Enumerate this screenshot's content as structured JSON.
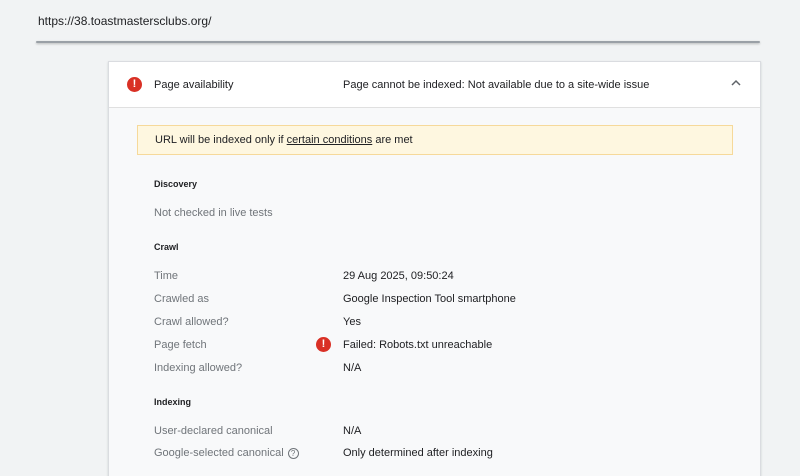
{
  "browser": {
    "url": "https://38.toastmastersclubs.org/"
  },
  "header": {
    "title": "Page availability",
    "status": "Page cannot be indexed: Not available due to a site-wide issue",
    "error_icon": "!",
    "chevron_icon": "chevron-up-icon"
  },
  "notice": {
    "prefix": "URL will be indexed only if ",
    "link": "certain conditions",
    "suffix": " are met",
    "bg_color": "#fef7e0"
  },
  "discovery": {
    "heading": "Discovery",
    "note": "Not checked in live tests"
  },
  "crawl": {
    "heading": "Crawl",
    "rows": [
      {
        "label": "Time",
        "value": "29 Aug 2025, 09:50:24"
      },
      {
        "label": "Crawled as",
        "value": "Google Inspection Tool smartphone"
      },
      {
        "label": "Crawl allowed?",
        "value": "Yes"
      },
      {
        "label": "Page fetch",
        "value": "Failed: Robots.txt unreachable"
      },
      {
        "label": "Indexing allowed?",
        "value": "N/A"
      }
    ],
    "error_icon": "!"
  },
  "indexing": {
    "heading": "Indexing",
    "rows": [
      {
        "label": "User-declared canonical",
        "value": "N/A"
      },
      {
        "label": "Google-selected canonical",
        "value": "Only determined after indexing"
      }
    ],
    "help_icon": "?"
  },
  "colors": {
    "error": "#d93025",
    "muted_text": "#70757a",
    "text": "#202124"
  }
}
